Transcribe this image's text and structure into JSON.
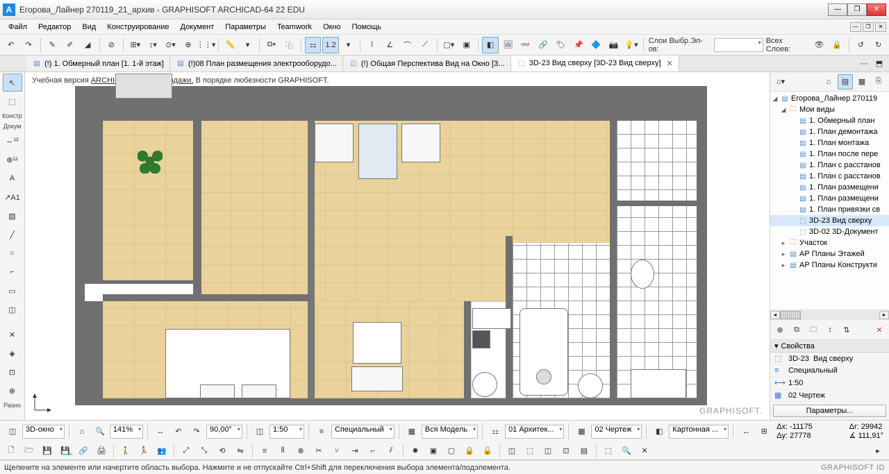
{
  "title": "Егорова_Лайнер 270119_21_архив - GRAPHISOFT ARCHICAD-64 22 EDU",
  "menus": [
    "Файл",
    "Редактор",
    "Вид",
    "Конструирование",
    "Документ",
    "Параметры",
    "Teamwork",
    "Окно",
    "Помощь"
  ],
  "layer_panel": {
    "sel_label": "Слои Выбр.Эл-ов:",
    "all_label": "Всех Слоев:"
  },
  "tabs": [
    {
      "icon": "folder",
      "label": "(!) 1. Обмерный план [1. 1-й этаж]"
    },
    {
      "icon": "folder",
      "label": "(!)08 План размещения электрооборудо..."
    },
    {
      "icon": "view3d",
      "label": "(!) Общая Перспектива Вид на Окно [З..."
    },
    {
      "icon": "view3d",
      "label": "3D-23 Вид сверху [3D-23 Вид сверху]",
      "active": true,
      "closeable": true
    }
  ],
  "left_tabs": [
    "Констр",
    "Докум",
    "Разно"
  ],
  "watermark_a": "Учебная версия ",
  "watermark_b": "ARCHICAD, не для продажи.",
  "watermark_c": " В порядке любезности GRAPHISOFT.",
  "graphisoft": "GRAPHISOFT.",
  "navigator": {
    "root": "Егорова_Лайнер 270119",
    "myviews": "Мои виды",
    "items": [
      "1. Обмерный план",
      "1. План демонтажа",
      "1. План монтажа",
      "1. План после пере",
      "1. План с расстанов",
      "1. План с расстанов",
      "1. План размещени",
      "1. План размещени",
      "1. План привязки св"
    ],
    "selected_3d": "3D-23 Вид сверху",
    "doc3d": "3D-02 3D-Документ",
    "groups": [
      "Участок",
      "АР Планы Этажей",
      "АР Планы Конструкти"
    ]
  },
  "properties": {
    "header": "Свойства",
    "name_prefix": "3D-23",
    "name_value": "Вид сверху",
    "special": "Специальный",
    "scale": "1:50",
    "sheet": "02 Чертеж",
    "button": "Параметры..."
  },
  "statusbar": {
    "window_label": "3D-окно",
    "zoom": "141%",
    "angle": "90,00°",
    "scale": "1:50",
    "special": "Специальный",
    "model": "Вся Модель",
    "arch": "01 Архитек...",
    "sheet": "02 Чертеж",
    "paper": "Картонная ...",
    "coords_left": {
      "l1": "Δx: -11175",
      "l2": "Δy: 27778"
    },
    "coords_right": {
      "l1": "Δr: 29942",
      "l2": "∡ 111,91°"
    }
  },
  "hint": "Щелкните на элементе или начертите область выбора. Нажмите и не отпускайте Ctrl+Shift для переключения выбора элемента/подэлемента.",
  "brand": "GRAPHISOFT ID"
}
